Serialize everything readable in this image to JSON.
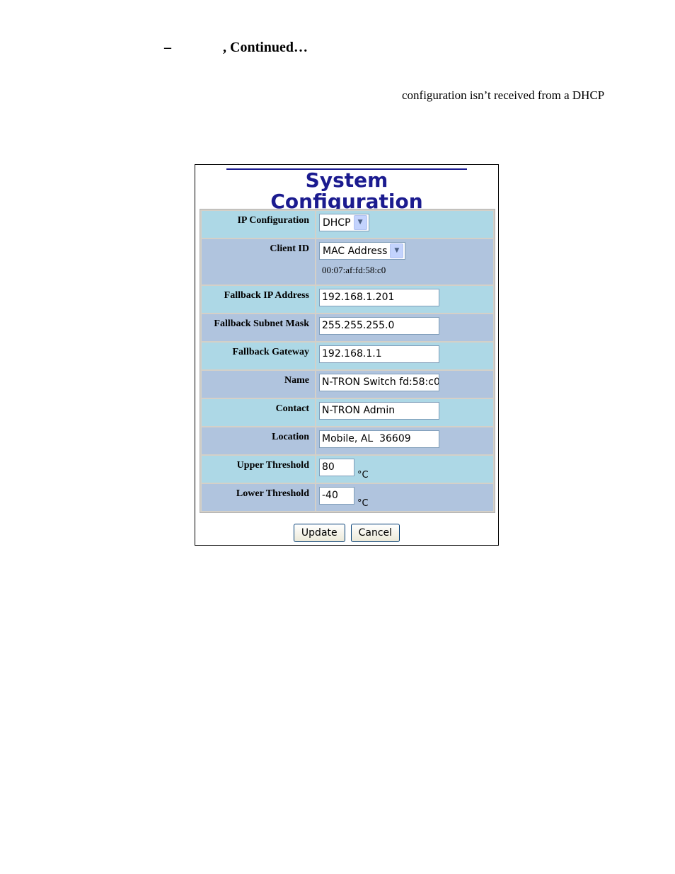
{
  "document": {
    "heading_dash": "–",
    "heading_suffix": ", Continued…",
    "text_line": "configuration isn’t received from a DHCP"
  },
  "panel": {
    "title": "System Configuration",
    "rows": {
      "ip_configuration": {
        "label": "IP Configuration",
        "value": "DHCP"
      },
      "client_id": {
        "label": "Client ID",
        "value": "MAC Address",
        "mac": "00:07:af:fd:58:c0"
      },
      "fallback_ip": {
        "label": "Fallback IP Address",
        "value": "192.168.1.201"
      },
      "fallback_subnet": {
        "label": "Fallback Subnet Mask",
        "value": "255.255.255.0"
      },
      "fallback_gateway": {
        "label": "Fallback Gateway",
        "value": "192.168.1.1"
      },
      "name": {
        "label": "Name",
        "value": "N-TRON Switch fd:58:c0"
      },
      "contact": {
        "label": "Contact",
        "value": "N-TRON Admin"
      },
      "location": {
        "label": "Location",
        "value": "Mobile, AL  36609"
      },
      "upper_threshold": {
        "label": "Upper Threshold",
        "value": "80",
        "unit": "°C"
      },
      "lower_threshold": {
        "label": "Lower Threshold",
        "value": "-40",
        "unit": "°C"
      }
    },
    "buttons": {
      "update": "Update",
      "cancel": "Cancel"
    },
    "icons": {
      "dropdown": "chevron-down-icon"
    },
    "colors": {
      "title": "#1b1b8f",
      "row_light": "#add8e6",
      "row_dark": "#b0c4de",
      "table_bg": "#d4d0c8"
    }
  }
}
